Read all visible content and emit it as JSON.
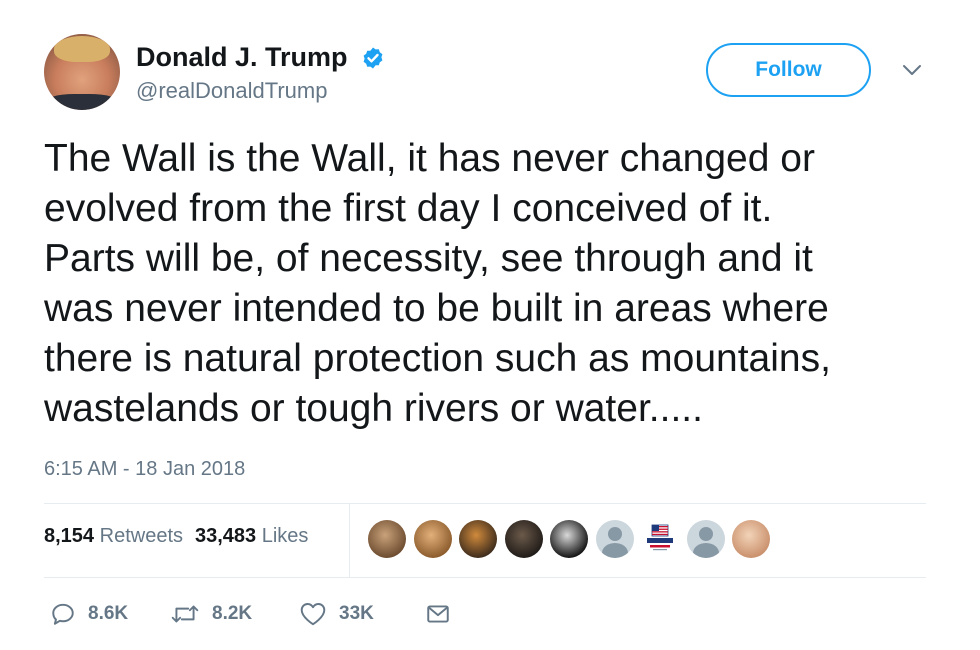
{
  "user": {
    "display_name": "Donald J. Trump",
    "handle": "@realDonaldTrump",
    "verified": true,
    "avatar": "user-avatar-photo"
  },
  "header": {
    "follow_label": "Follow",
    "menu_icon": "chevron-down-icon"
  },
  "tweet": {
    "text": "The Wall is the Wall, it has never changed or\nevolved from the first day I conceived of it.\nParts will be, of necessity, see through and it\nwas never intended to be built in areas where\nthere is natural protection such as mountains,\nwastelands or tough rivers or water.....",
    "timestamp": "6:15 AM - 18 Jan 2018"
  },
  "stats": {
    "retweets_count": "8,154",
    "retweets_label": "Retweets",
    "likes_count": "33,483",
    "likes_label": "Likes"
  },
  "likers": [
    {
      "kind": "photo",
      "colors": [
        "#6b4a2e",
        "#c9a27a"
      ]
    },
    {
      "kind": "photo",
      "colors": [
        "#8a5a2b",
        "#e2b07a"
      ]
    },
    {
      "kind": "photo",
      "colors": [
        "#3b2a1c",
        "#d08a3c"
      ]
    },
    {
      "kind": "photo",
      "colors": [
        "#1f1a17",
        "#6b5a4a"
      ]
    },
    {
      "kind": "photo",
      "colors": [
        "#0f0f0f",
        "#d9d9d9"
      ]
    },
    {
      "kind": "default"
    },
    {
      "kind": "logo"
    },
    {
      "kind": "default"
    },
    {
      "kind": "photo",
      "colors": [
        "#c98f6b",
        "#f2d3b8"
      ]
    }
  ],
  "actions": {
    "reply_count": "8.6K",
    "retweet_count": "8.2K",
    "like_count": "33K",
    "reply_icon": "reply-icon",
    "retweet_icon": "retweet-icon",
    "like_icon": "heart-icon",
    "dm_icon": "envelope-icon"
  },
  "colors": {
    "accent": "#1da1f2",
    "text": "#14171a",
    "secondary": "#657786",
    "divider": "#e6ecf0"
  }
}
